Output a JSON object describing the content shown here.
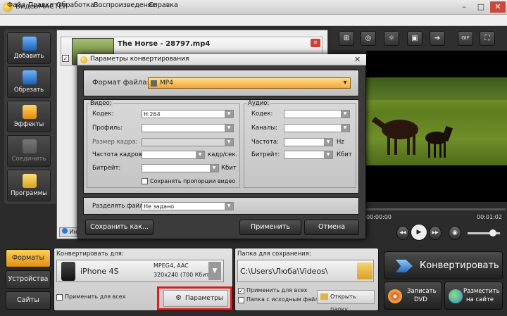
{
  "app": {
    "title": "ВидеоМАСТЕР",
    "win_min": "–",
    "win_max": "□",
    "win_close": "✕"
  },
  "menu": [
    "Файл",
    "Правка",
    "Обработка",
    "Воспроизведение",
    "Справка"
  ],
  "sidebar": {
    "items": [
      {
        "label": "Добавить",
        "icon": "add-video-icon"
      },
      {
        "label": "Обрезать",
        "icon": "trim-icon"
      },
      {
        "label": "Эффекты",
        "icon": "effects-icon"
      },
      {
        "label": "Соединить",
        "icon": "join-icon",
        "disabled": true
      },
      {
        "label": "Программы",
        "icon": "programs-icon"
      }
    ]
  },
  "file": {
    "name": "The Horse - 28797.mp4",
    "check": "✓",
    "remove": "✕"
  },
  "info_tab": "Ин",
  "toolbar_right": {
    "icons": [
      "crop-icon",
      "snapshot-icon",
      "brightness-icon",
      "speed-icon",
      "run-icon",
      "gif-icon",
      "fullscreen-icon"
    ],
    "gif_label": "GIF"
  },
  "player": {
    "time_start": "00:00:00",
    "time_end": "00:01:02",
    "prev": "◀◀",
    "play": "▶",
    "next": "▶▶",
    "volume_icon": "◉",
    "volume_level": 0.78
  },
  "tabs": [
    "Форматы",
    "Устройства",
    "Сайты"
  ],
  "convert_for": {
    "label": "Конвертировать для:",
    "device": "iPhone 4S",
    "codec": "MPEG4, AAC",
    "spec": "320x240 (700 Кбит)",
    "apply_all": "Применить для всех",
    "params_button": "Параметры",
    "chevron": "▼"
  },
  "save": {
    "label": "Папка для сохранения:",
    "path": "C:\\Users\\Люба\\Videos\\",
    "apply_all": "Применить для всех",
    "source_folder": "Папка с исходным файлом",
    "open_folder": "Открыть папку",
    "apply_all_checked": "✓"
  },
  "actions": {
    "convert": "Конвертировать",
    "dvd_line1": "Записать",
    "dvd_line2": "DVD",
    "web_line1": "Разместить",
    "web_line2": "на сайте"
  },
  "dialog": {
    "title": "Параметры конвертирования",
    "close": "✕",
    "format_label": "Формат файла:",
    "format_value": "MP4",
    "video_title": "Видео:",
    "audio_title": "Аудио:",
    "video_fields": [
      {
        "label": "Кодек:",
        "value": "H.264",
        "disabled": false
      },
      {
        "label": "Профиль:",
        "value": "",
        "disabled": false
      },
      {
        "label": "Размер кадра:",
        "value": "",
        "disabled": true
      },
      {
        "label": "Частота кадров:",
        "value": "",
        "unit": "кадр/сек.",
        "disabled": false
      },
      {
        "label": "Битрейт:",
        "value": "",
        "unit": "Кбит",
        "disabled": false
      }
    ],
    "keep_ratio": "Сохранять пропорции видео",
    "audio_fields": [
      {
        "label": "Кодек:",
        "value": ""
      },
      {
        "label": "Каналы:",
        "value": ""
      },
      {
        "label": "Частота:",
        "value": "",
        "unit": "Hz"
      },
      {
        "label": "Битрейт:",
        "value": "",
        "unit": "Кбит"
      }
    ],
    "split_label": "Разделять файл:",
    "split_value": "Не задано",
    "btn_save_as": "Сохранить как...",
    "btn_apply": "Применить",
    "btn_cancel": "Отмена"
  }
}
